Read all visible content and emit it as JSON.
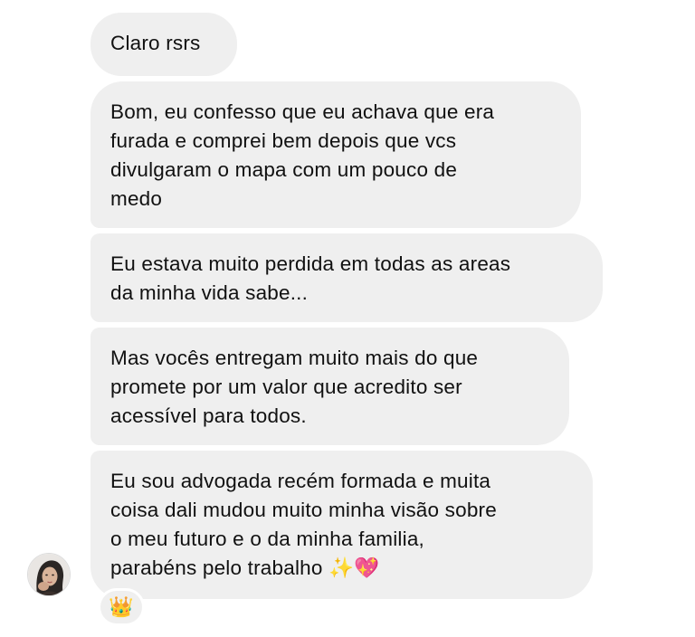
{
  "messages": [
    {
      "text": "Claro rsrs"
    },
    {
      "text": "Bom, eu confesso que eu achava que era\nfurada e comprei bem depois que vcs\ndivulgaram o mapa com um pouco de\nmedo"
    },
    {
      "text": "Eu estava muito perdida em todas as areas\nda minha vida sabe..."
    },
    {
      "text": "Mas vocês entregam muito mais do que\npromete por um valor que acredito ser\nacessível para todos."
    },
    {
      "text": "Eu sou advogada recém formada e muita\ncoisa dali mudou muito minha visão sobre\no meu futuro e o da minha familia,\nparabéns pelo trabalho ✨💖"
    }
  ],
  "reaction": {
    "emoji": "👑"
  },
  "sender": {
    "avatar_icon": "profile-photo"
  },
  "colors": {
    "bubble_bg": "#efefef",
    "text": "#111111",
    "page_bg": "#ffffff"
  }
}
